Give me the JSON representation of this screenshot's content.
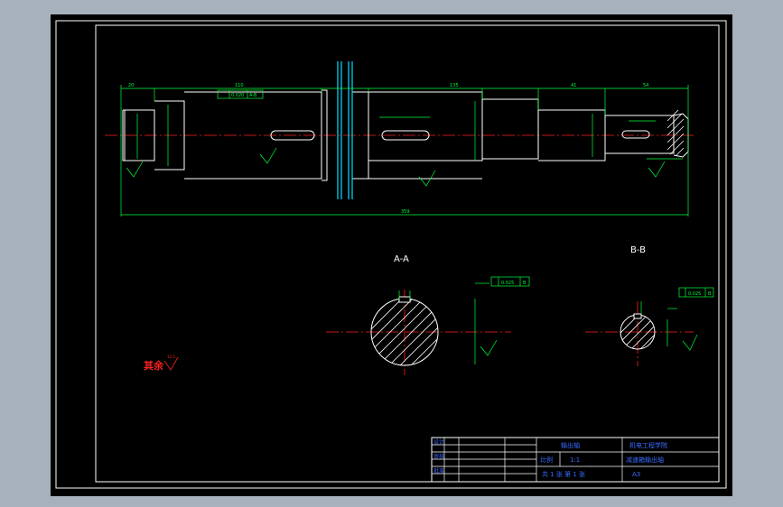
{
  "colors": {
    "background": "#a7b0bd",
    "canvas": "#000000",
    "frame": "#ffffff",
    "centerline": "#ff2020",
    "dimension": "#00ff3a",
    "hatch": "#ffffff",
    "cyan": "#00e0ff",
    "title_text": "#3a6bff",
    "label_red": "#ff2020"
  },
  "drawing": {
    "section_a_title": "A-A",
    "section_b_title": "B-B",
    "remaining_roughness_label": "其余",
    "remaining_roughness_value": "12.5"
  },
  "title_block": {
    "part_name": "输出轴",
    "school": "机电工程学院",
    "scale_label": "比例",
    "scale_value": "1:1",
    "drawing_title": "减速箱输出轴",
    "bottom_left": "共 1 张 第 1 张",
    "sheet_size": "A3",
    "roles": [
      "设计",
      "审核",
      "批准"
    ]
  },
  "dimensions": {
    "overall_length": "359",
    "seg_left": "20",
    "seg_2": "110",
    "seg_mid": "135",
    "seg_r1": "41",
    "seg_r2": "54",
    "tol_1": "0.020",
    "tol_2": "0.025",
    "datum_ref": "A-B",
    "datum_ref_2": "B"
  }
}
